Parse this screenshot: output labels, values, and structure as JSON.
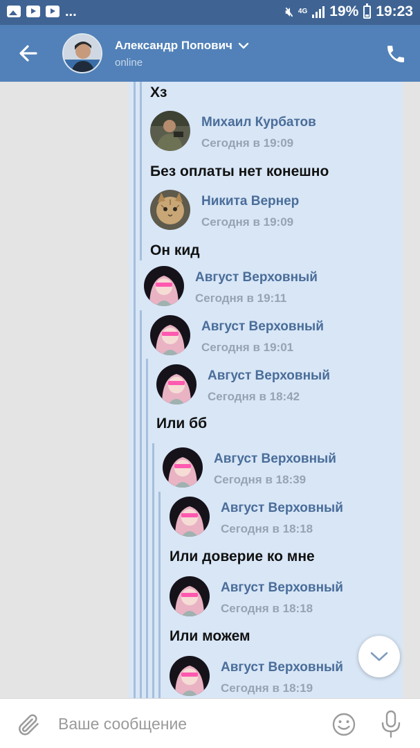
{
  "status_bar": {
    "left_icons": [
      "image-icon",
      "youtube-icon",
      "youtube-icon"
    ],
    "overflow": "...",
    "network": "4G",
    "battery_percent": "19%",
    "time": "19:23"
  },
  "header": {
    "contact_name": "Александр Попович",
    "contact_status": "online"
  },
  "forwarded": [
    {
      "text": "Хз"
    },
    {
      "name": "Михаил Курбатов",
      "time": "Сегодня в 19:09",
      "avatar": "military-man-photo"
    },
    {
      "text": "Без оплаты нет конешно"
    },
    {
      "name": "Никита Вернер",
      "time": "Сегодня в 19:09",
      "avatar": "cat-photo"
    },
    {
      "text": "Он кид"
    },
    {
      "name": "Август Верховный",
      "time": "Сегодня в 19:11",
      "avatar": "anime-girl"
    },
    {
      "name": "Август Верховный",
      "time": "Сегодня в 19:01",
      "avatar": "anime-girl"
    },
    {
      "name": "Август Верховный",
      "time": "Сегодня в 18:42",
      "avatar": "anime-girl"
    },
    {
      "text": "Или бб"
    },
    {
      "name": "Август Верховный",
      "time": "Сегодня в 18:39",
      "avatar": "anime-girl"
    },
    {
      "name": "Август Верховный",
      "time": "Сегодня в 18:18",
      "avatar": "anime-girl"
    },
    {
      "text": "Или доверие ко мне"
    },
    {
      "name": "Август Верховный",
      "time": "Сегодня в 18:18",
      "avatar": "anime-girl"
    },
    {
      "text": "Или можем"
    },
    {
      "name": "Август Верховный",
      "time": "Сегодня в 18:19",
      "avatar": "anime-girl"
    }
  ],
  "input": {
    "placeholder": "Ваше сообщение",
    "value": ""
  },
  "colors": {
    "status_bar": "#3f6494",
    "header": "#5181b8",
    "bubble": "#d8e6f6",
    "thread_line": "#a5bfdc",
    "author_name": "#4a6d99",
    "timestamp": "#96a3b3"
  }
}
